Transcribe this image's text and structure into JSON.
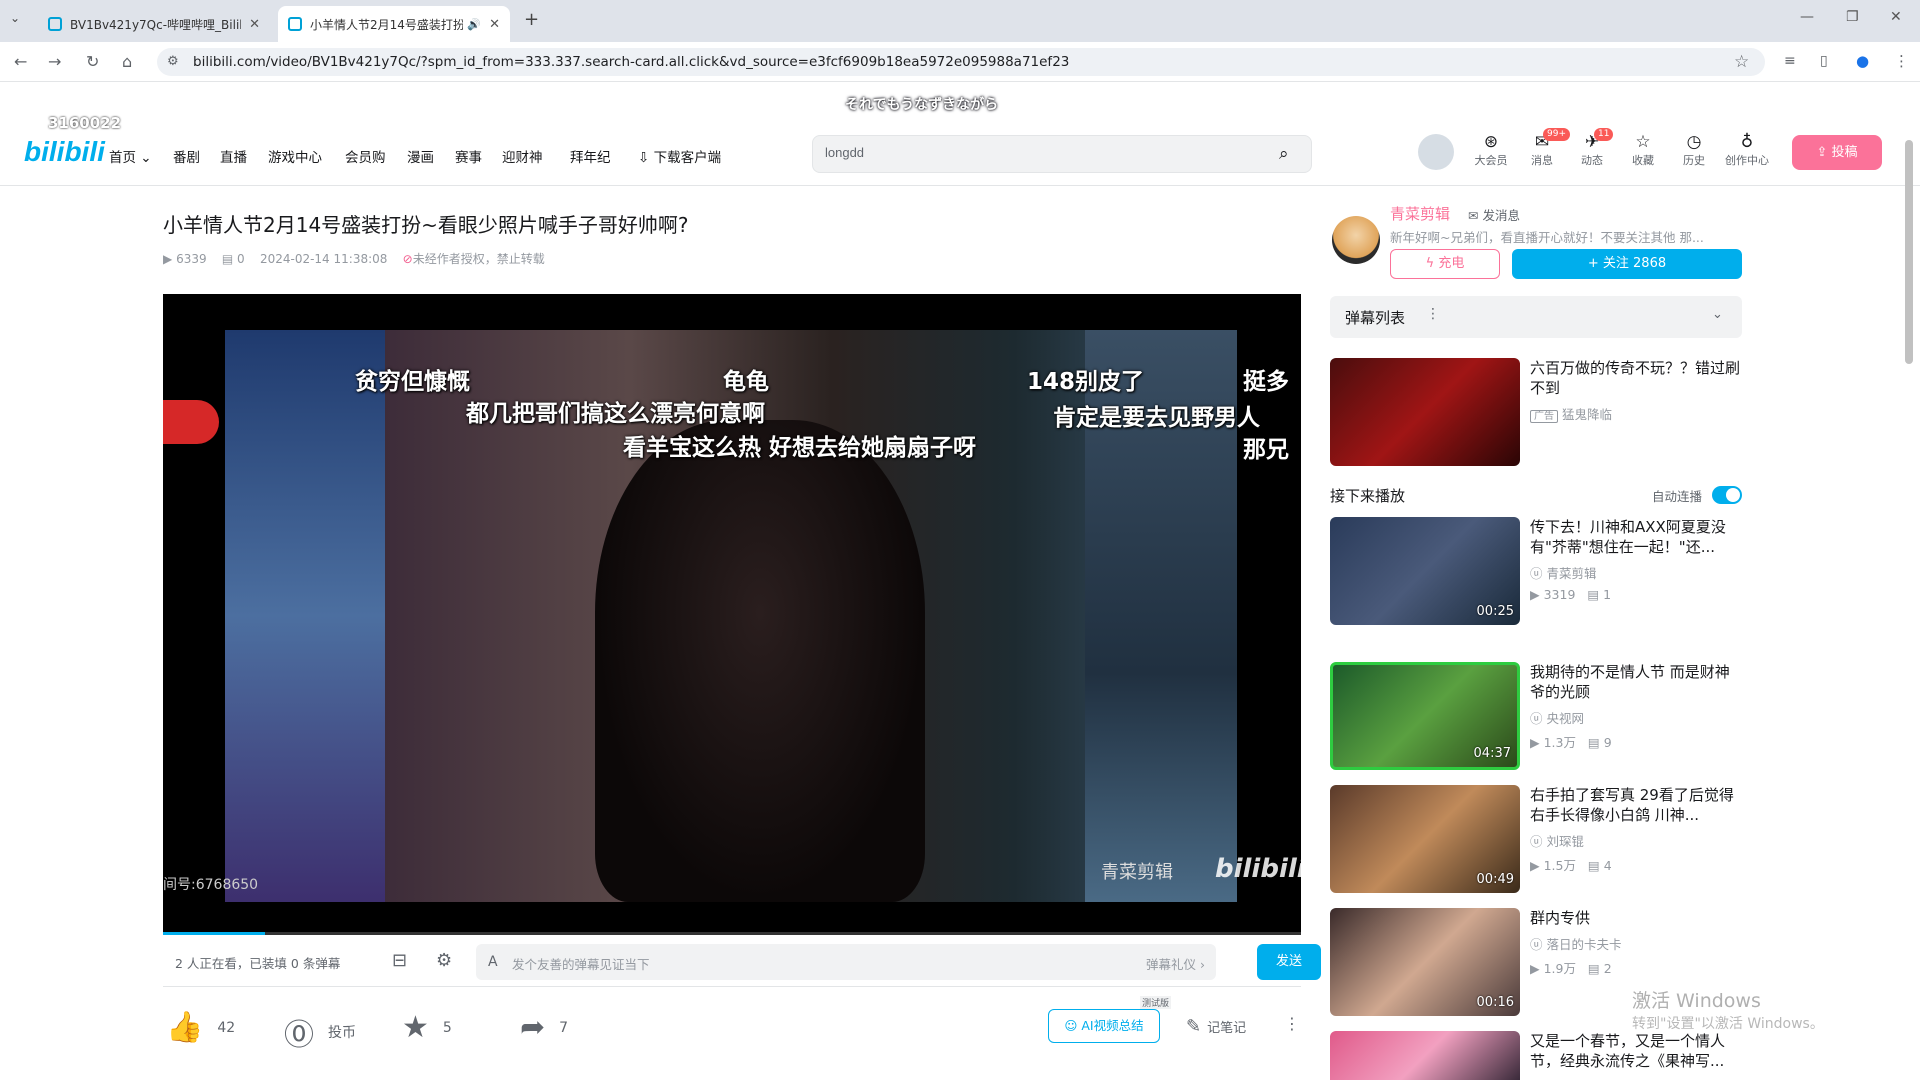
{
  "browser": {
    "tabs": [
      {
        "title": "BV1Bv421y7Qc-哔哩哔哩_Bilibili"
      },
      {
        "title": "小羊情人节2月14号盛装打扮~"
      }
    ],
    "url": "bilibili.com/video/BV1Bv421y7Qc/?spm_id_from=333.337.search-card.all.click&vd_source=e3fcf6909b18ea5972e095988a71ef23"
  },
  "overlay": {
    "lyric": "それでもうなずきながら",
    "counter": "3160022"
  },
  "header": {
    "logo": "bilibili",
    "nav": [
      "首页",
      "番剧",
      "直播",
      "游戏中心",
      "会员购",
      "漫画",
      "赛事",
      "迎财神",
      "拜年纪",
      "下载客户端"
    ],
    "search_value": "longdd",
    "icons": [
      {
        "label": "大会员"
      },
      {
        "label": "消息",
        "badge": "99+"
      },
      {
        "label": "动态",
        "badge": "11"
      },
      {
        "label": "收藏"
      },
      {
        "label": "历史"
      },
      {
        "label": "创作中心"
      }
    ],
    "upload_label": "投稿"
  },
  "video": {
    "title": "小羊情人节2月14号盛装打扮~看眼少照片喊手子哥好帅啊?",
    "views": "6339",
    "danmaku_count": "0",
    "date": "2024-02-14 11:38:08",
    "copyright": "未经作者授权，禁止转载",
    "danmaku_texts": [
      "贫穷但慷慨",
      "龟龟",
      "148别皮了",
      "挺多",
      "都几把哥们搞这么漂亮何意啊",
      "肯定是要去见野男人",
      "看羊宝这么热 好想去给她扇扇子呀",
      "那兄"
    ],
    "watermark": "青菜剪辑",
    "room": "间号:6768650",
    "progress": 0.09
  },
  "danmaku_bar": {
    "watching": "2 人正在看，已装填 0 条弹幕",
    "placeholder": "发个友善的弹幕见证当下",
    "etiquette": "弹幕礼仪 ›",
    "send": "发送"
  },
  "actions": {
    "like": "42",
    "coin": "投币",
    "fav": "5",
    "share": "7",
    "ai_summary": "AI视频总结",
    "ai_tag": "测试版",
    "notes": "记笔记"
  },
  "uploader": {
    "name": "青菜剪辑",
    "message": "发消息",
    "desc": "新年好啊~兄弟们，看直播开心就好！不要关注其他 那...",
    "charge": "充电",
    "follow": "关注 2868"
  },
  "danmaku_list": {
    "label": "弹幕列表"
  },
  "ad": {
    "title": "六百万做的传奇不玩？？错过刷不到",
    "tag": "广告",
    "source": "猛鬼降临"
  },
  "next": {
    "heading": "接下来播放",
    "autoplay": "自动连播"
  },
  "recommendations": [
    {
      "title": "传下去！川神和AXX阿夏夏没有\"芥蒂\"想住在一起！\"还...",
      "up": "青菜剪辑",
      "views": "3319",
      "comments": "1",
      "duration": "00:25"
    },
    {
      "title": "我期待的不是情人节 而是财神爷的光顾",
      "up": "央视网",
      "views": "1.3万",
      "comments": "9",
      "duration": "04:37"
    },
    {
      "title": "右手拍了套写真 29看了后觉得右手长得像小白鸽 川神...",
      "up": "刘琛锟",
      "views": "1.5万",
      "comments": "4",
      "duration": "00:49"
    },
    {
      "title": "群内专供",
      "up": "落日的卡夫卡",
      "views": "1.9万",
      "comments": "2",
      "duration": "00:16"
    },
    {
      "title": "又是一个春节，又是一个情人节，经典永流传之《果神写...",
      "up": "",
      "views": "",
      "comments": "",
      "duration": ""
    }
  ],
  "windows_watermark": {
    "line1": "激活 Windows",
    "line2": "转到\"设置\"以激活 Windows。"
  },
  "colors": {
    "accent": "#00aeec",
    "pink": "#fb7299"
  }
}
